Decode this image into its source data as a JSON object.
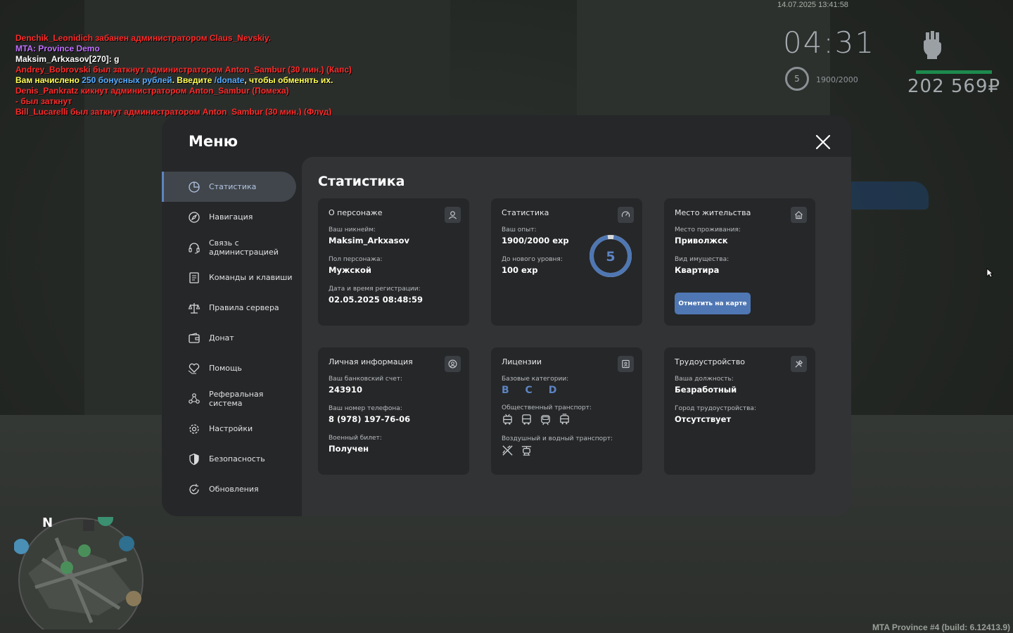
{
  "chat": [
    {
      "parts": [
        {
          "t": "Denchik_Leonidich забанен администратором Claus_Nevskiy.",
          "c": "red"
        }
      ]
    },
    {
      "parts": [
        {
          "t": "MTA: Province Demo",
          "c": "purple"
        }
      ]
    },
    {
      "parts": [
        {
          "t": "Maksim_Arkxasov[270]: g",
          "c": "white"
        }
      ]
    },
    {
      "parts": [
        {
          "t": "Andrey_Bobrovski был заткнут администратором Anton_Sambur (30 мин.) (Капс)",
          "c": "red"
        }
      ]
    },
    {
      "parts": [
        {
          "t": "Вам начислено ",
          "c": "yellow"
        },
        {
          "t": "250 бонусных рублей",
          "c": "blue"
        },
        {
          "t": ". Введите ",
          "c": "yellow"
        },
        {
          "t": "/donate",
          "c": "blue"
        },
        {
          "t": ", чтобы обменять их.",
          "c": "yellow"
        }
      ]
    },
    {
      "parts": [
        {
          "t": "Denis_Pankratz кикнут администратором Anton_Sambur (Помеха)",
          "c": "red"
        }
      ]
    },
    {
      "parts": [
        {
          "t": "- был заткнут",
          "c": "red"
        }
      ]
    },
    {
      "parts": [
        {
          "t": "Bill_Lucarelli был заткнут администратором Anton_Sambur (30 мин.) (Флуд)",
          "c": "red"
        }
      ]
    }
  ],
  "hud": {
    "datetime": "14.07.2025 13:41:58",
    "time": "04:31",
    "level": "5",
    "exp": "1900/2000",
    "money": "202 569₽",
    "health_fraction": 1.0,
    "health_color": "#1d8a4d"
  },
  "build": "MTA Province #4 (build: 6.12413.9)",
  "minimap": {
    "north": "N"
  },
  "menu": {
    "title": "Меню",
    "nav": [
      {
        "id": "stats",
        "label": "Статистика",
        "icon": "pie-chart-icon",
        "active": true
      },
      {
        "id": "navigation",
        "label": "Навигация",
        "icon": "compass-icon"
      },
      {
        "id": "admin",
        "label": "Связь с администрацией",
        "icon": "headset-icon"
      },
      {
        "id": "commands",
        "label": "Команды и клавиши",
        "icon": "document-icon"
      },
      {
        "id": "rules",
        "label": "Правила сервера",
        "icon": "scales-icon"
      },
      {
        "id": "donate",
        "label": "Донат",
        "icon": "wallet-icon"
      },
      {
        "id": "help",
        "label": "Помощь",
        "icon": "heart-hand-icon"
      },
      {
        "id": "referral",
        "label": "Реферальная система",
        "icon": "people-icon"
      },
      {
        "id": "settings",
        "label": "Настройки",
        "icon": "gear-icon"
      },
      {
        "id": "security",
        "label": "Безопасность",
        "icon": "shield-icon"
      },
      {
        "id": "updates",
        "label": "Обновления",
        "icon": "refresh-icon"
      }
    ]
  },
  "content": {
    "title": "Статистика",
    "character": {
      "title": "О персонаже",
      "nick_label": "Ваш никнейм:",
      "nick": "Maksim_Arkxasov",
      "gender_label": "Пол персонажа:",
      "gender": "Мужской",
      "reg_label": "Дата и время регистрации:",
      "reg": "02.05.2025 08:48:59"
    },
    "stats": {
      "title": "Статистика",
      "exp_label": "Ваш опыт:",
      "exp": "1900/2000 exp",
      "next_label": "До нового уровня:",
      "next": "100 exp",
      "level": "5",
      "progress_fraction": 0.95,
      "ring_color": "#4f77b3"
    },
    "residence": {
      "title": "Место жительства",
      "place_label": "Место проживания:",
      "place": "Приволжск",
      "property_label": "Вид имущества:",
      "property": "Квартира",
      "map_button": "Отметить на карте"
    },
    "personal": {
      "title": "Личная информация",
      "bank_label": "Ваш банковский счет:",
      "bank": "243910",
      "phone_label": "Ваш номер телефона:",
      "phone": "8 (978) 197-76-06",
      "military_label": "Военный билет:",
      "military": "Получен"
    },
    "licenses": {
      "title": "Лицензии",
      "basic_label": "Базовые категории:",
      "basic": "B C D",
      "public_label": "Общественный транспорт:",
      "public_icons": [
        "trolleybus-icon",
        "bus-icon",
        "tram-icon",
        "minibus-icon"
      ],
      "air_label": "Воздушный и водный транспорт:",
      "air_icons": [
        "plane-icon",
        "helicopter-icon"
      ]
    },
    "employment": {
      "title": "Трудоустройство",
      "position_label": "Ваша должность:",
      "position": "Безработный",
      "city_label": "Город трудоустройства:",
      "city": "Отсутствует"
    }
  },
  "colors": {
    "accent": "#4f77b3",
    "accent_light": "#5d84c2",
    "chat_red": "#ff2a2a"
  }
}
